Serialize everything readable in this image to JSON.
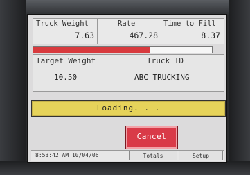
{
  "readings": {
    "truck_weight_label": "Truck Weight",
    "truck_weight_value": "7.63",
    "rate_label": "Rate",
    "rate_value": "467.28",
    "time_to_fill_label": "Time to Fill",
    "time_to_fill_value": "8.37"
  },
  "progress": {
    "fill_fraction": 0.65,
    "color": "#d83a3e"
  },
  "info": {
    "target_weight_label": "Target Weight",
    "target_weight_value": "10.50",
    "truck_id_label": "Truck ID",
    "truck_id_value": "ABC TRUCKING"
  },
  "status": {
    "text": "Loading. . .",
    "color": "#e6d35a"
  },
  "actions": {
    "cancel_label": "Cancel",
    "cancel_color": "#d93a48"
  },
  "footer": {
    "timestamp": "8:53:42 AM 10/04/06",
    "totals_label": "Totals",
    "setup_label": "Setup"
  }
}
